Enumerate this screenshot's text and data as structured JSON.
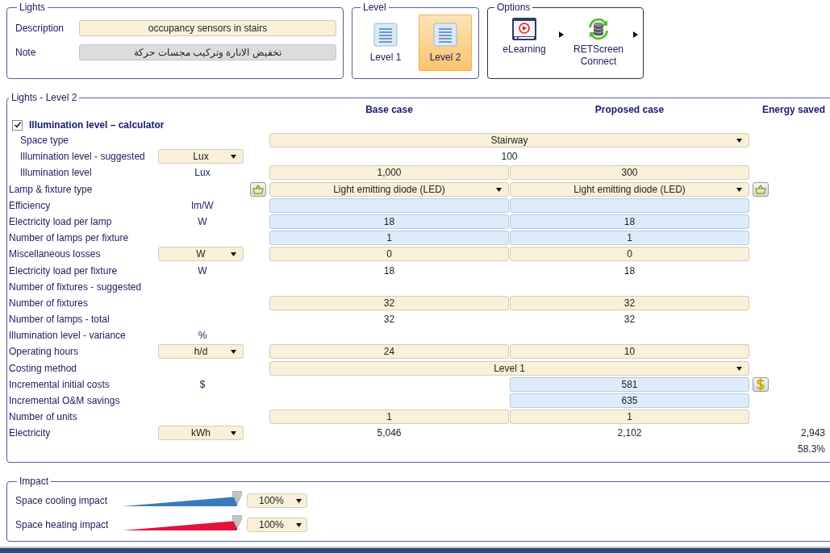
{
  "lights": {
    "title": "Lights",
    "fields": [
      {
        "label": "Description",
        "value": "occupancy sensors in stairs",
        "kind": "input"
      },
      {
        "label": "Note",
        "value": "تخفيض الانارة وتركيب مجسات حركة",
        "kind": "readonly"
      }
    ]
  },
  "level": {
    "title": "Level",
    "items": [
      {
        "label": "Level 1",
        "selected": false
      },
      {
        "label": "Level 2",
        "selected": true
      }
    ]
  },
  "options": {
    "title": "Options",
    "items": [
      {
        "label": "eLearning",
        "kind": "video"
      },
      {
        "label": "RETScreen Connect",
        "kind": "sync"
      }
    ]
  },
  "calc": {
    "title": "Lights - Level 2",
    "columns": [
      "Base case",
      "Proposed case",
      "Energy saved"
    ],
    "calculator": {
      "label": "Illumination level – calculator",
      "checked": true,
      "children": [
        {
          "label": "Space type",
          "span": {
            "kind": "select",
            "value": "Stairway"
          }
        },
        {
          "label": "Illumination level - suggested",
          "unit": {
            "kind": "select",
            "value": "Lux"
          },
          "span": {
            "kind": "text",
            "value": "100"
          }
        },
        {
          "label": "Illumination level",
          "unit": {
            "kind": "text",
            "value": "Lux"
          },
          "base": {
            "kind": "input",
            "value": "1,000"
          },
          "proposed": {
            "kind": "input",
            "value": "300"
          }
        }
      ]
    },
    "rows": [
      {
        "label": "Lamp & fixture type",
        "left_tool": {
          "kind": "basket"
        },
        "base": {
          "kind": "select",
          "value": "Light emitting diode (LED)"
        },
        "proposed": {
          "kind": "select",
          "value": "Light emitting diode (LED)"
        },
        "right_tool": {
          "kind": "basket"
        }
      },
      {
        "label": "Efficiency",
        "unit": {
          "kind": "text",
          "value": "lm/W"
        },
        "base": {
          "kind": "calc"
        },
        "proposed": {
          "kind": "calc"
        }
      },
      {
        "label": "Electricity load per lamp",
        "unit": {
          "kind": "text",
          "value": "W"
        },
        "base": {
          "kind": "calc",
          "value": "18"
        },
        "proposed": {
          "kind": "calc",
          "value": "18"
        }
      },
      {
        "label": "Number of lamps per fixture",
        "base": {
          "kind": "calc",
          "value": "1"
        },
        "proposed": {
          "kind": "calc",
          "value": "1"
        }
      },
      {
        "label": "Miscellaneous losses",
        "unit": {
          "kind": "select",
          "value": "W"
        },
        "base": {
          "kind": "input",
          "value": "0"
        },
        "proposed": {
          "kind": "input",
          "value": "0"
        }
      },
      {
        "label": "Electricity load per fixture",
        "unit": {
          "kind": "text",
          "value": "W"
        },
        "base": {
          "kind": "text",
          "value": "18"
        },
        "proposed": {
          "kind": "text",
          "value": "18"
        }
      },
      {
        "label": "Number of fixtures - suggested"
      },
      {
        "label": "Number of fixtures",
        "base": {
          "kind": "input",
          "value": "32"
        },
        "proposed": {
          "kind": "input",
          "value": "32"
        }
      },
      {
        "label": "Number of lamps - total",
        "base": {
          "kind": "text",
          "value": "32"
        },
        "proposed": {
          "kind": "text",
          "value": "32"
        }
      },
      {
        "label": "Illumination level - variance",
        "unit": {
          "kind": "text",
          "value": "%"
        }
      },
      {
        "label": "Operating hours",
        "unit": {
          "kind": "select",
          "value": "h/d"
        },
        "base": {
          "kind": "input",
          "value": "24"
        },
        "proposed": {
          "kind": "input",
          "value": "10"
        }
      },
      {
        "label": "Costing method",
        "span": {
          "kind": "select",
          "value": "Level 1"
        }
      },
      {
        "label": "Incremental initial costs",
        "unit": {
          "kind": "text",
          "value": "$"
        },
        "proposed": {
          "kind": "calc",
          "value": "581"
        },
        "right_tool": {
          "kind": "dollar"
        }
      },
      {
        "label": "Incremental O&M savings",
        "proposed": {
          "kind": "calc",
          "value": "635"
        }
      },
      {
        "label": "Number of units",
        "base": {
          "kind": "input",
          "value": "1"
        },
        "proposed": {
          "kind": "input",
          "value": "1"
        }
      },
      {
        "label": "Electricity",
        "unit": {
          "kind": "select",
          "value": "kWh"
        },
        "base": {
          "kind": "text",
          "value": "5,046"
        },
        "proposed": {
          "kind": "text",
          "value": "2,102"
        },
        "saved": [
          "2,943",
          "58.3%"
        ]
      }
    ]
  },
  "impact": {
    "title": "Impact",
    "items": [
      {
        "label": "Space cooling impact",
        "level": 1,
        "color": "#3a7ab8",
        "value": "100%"
      },
      {
        "label": "Space heating impact",
        "level": 1,
        "color": "#e0143c",
        "value": "100%"
      }
    ]
  }
}
